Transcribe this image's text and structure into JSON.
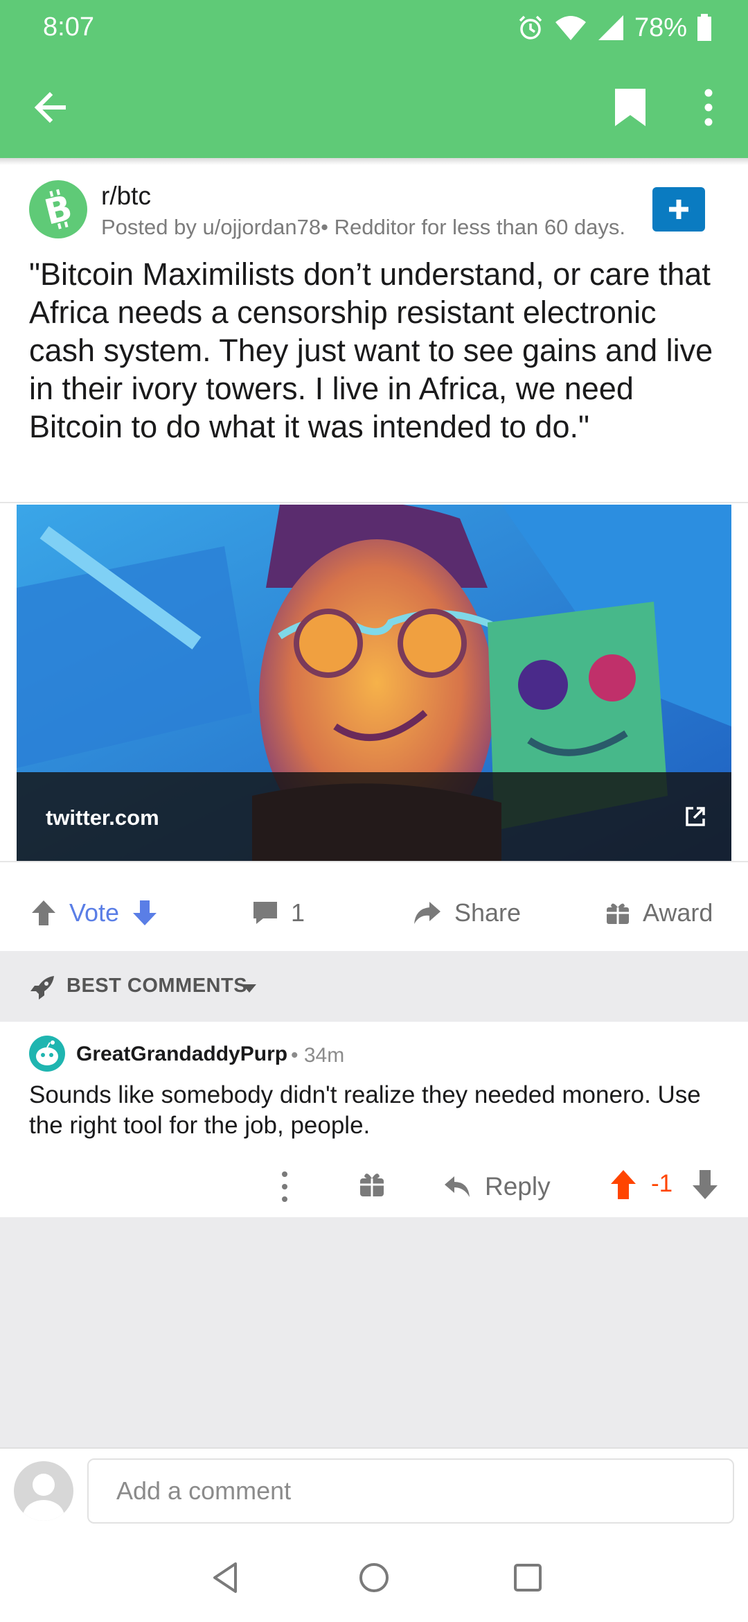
{
  "status_bar": {
    "time": "8:07",
    "battery": "78%",
    "icons": [
      "alarm-icon",
      "wifi-icon",
      "cell-signal-icon",
      "battery-icon"
    ]
  },
  "app_bar": {
    "icons": [
      "back-arrow-icon",
      "bookmark-icon",
      "overflow-menu-icon"
    ],
    "color": "#5fca77"
  },
  "post": {
    "subreddit": "r/btc",
    "meta": "Posted by u/ojjordan78• Redditor for less than 60 days.",
    "title": "\"Bitcoin Maximilists don’t understand, or care that Africa needs a censorship resistant electronic cash system. They just want to see gains and live in their ivory towers. I live in Africa, we need Bitcoin to do what it was intended to do.\"",
    "link_domain": "twitter.com"
  },
  "actions": {
    "vote": "Vote",
    "comments": "1",
    "share": "Share",
    "award": "Award",
    "vote_color": "#5a7ee6"
  },
  "sort": {
    "label": "BEST COMMENTS"
  },
  "comment": {
    "user": "GreatGrandaddyPurp",
    "time": "• 34m",
    "body": "Sounds like somebody didn't realize they needed monero. Use the right tool for the job, people.",
    "reply": "Reply",
    "score": "-1",
    "score_color": "#ff4500"
  },
  "composer": {
    "placeholder": "Add a comment"
  }
}
